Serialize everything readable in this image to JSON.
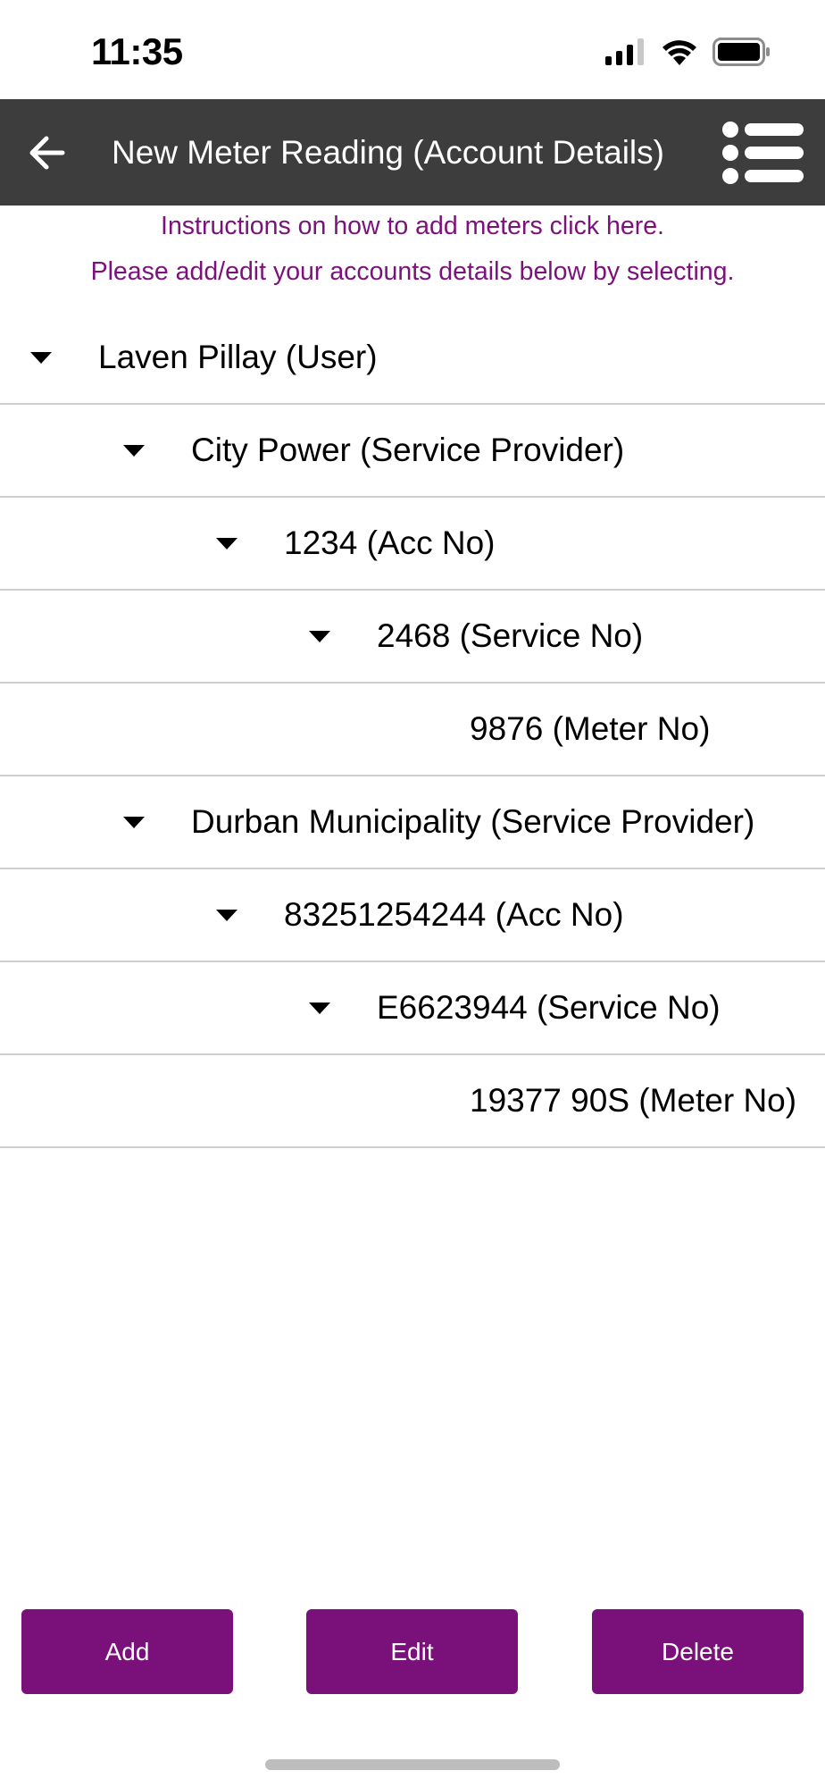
{
  "status_bar": {
    "time": "11:35"
  },
  "header": {
    "title": "New Meter Reading (Account Details)"
  },
  "instructions": {
    "line1": "Instructions on how to add meters click here.",
    "line2": "Please add/edit your accounts details below by selecting."
  },
  "tree": [
    {
      "label": "Laven Pillay (User)",
      "level": 0,
      "expanded": true
    },
    {
      "label": "City Power (Service Provider)",
      "level": 1,
      "expanded": true
    },
    {
      "label": "1234 (Acc No)",
      "level": 2,
      "expanded": true
    },
    {
      "label": "2468 (Service No)",
      "level": 3,
      "expanded": true
    },
    {
      "label": "9876 (Meter No)",
      "level": 4,
      "expanded": false
    },
    {
      "label": "Durban Municipality (Service Provider)",
      "level": 1,
      "expanded": true
    },
    {
      "label": "83251254244 (Acc No)",
      "level": 2,
      "expanded": true
    },
    {
      "label": "E6623944 (Service No)",
      "level": 3,
      "expanded": true
    },
    {
      "label": "19377 90S (Meter No)",
      "level": 4,
      "expanded": false
    }
  ],
  "buttons": {
    "add": "Add",
    "edit": "Edit",
    "delete": "Delete"
  },
  "colors": {
    "header_bg": "#3d3d3d",
    "accent": "#7a1079",
    "instruction_text": "#7b127b"
  }
}
